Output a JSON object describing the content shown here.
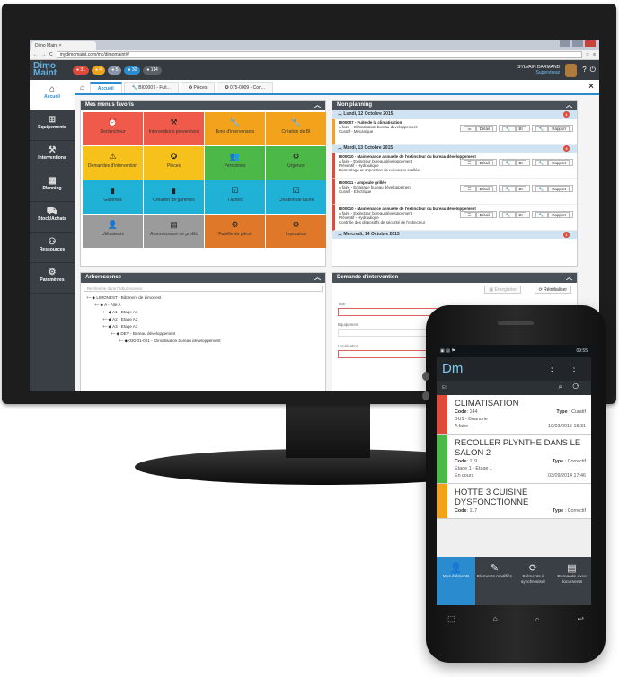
{
  "browser": {
    "tab_title": "Dimo Maint",
    "url": "mydimomaint.com/mc/dimomaint#/"
  },
  "header": {
    "logo": "Dimo Maint",
    "badges": [
      {
        "label": "31",
        "color": "#e04a3a"
      },
      {
        "label": "4",
        "color": "#f2a31b"
      },
      {
        "label": "5",
        "color": "#8a96a8"
      },
      {
        "label": "30",
        "color": "#2a8ccf"
      },
      {
        "label": "114",
        "color": "#5a6068"
      }
    ],
    "user_name": "SYLVAIN DARMAND",
    "user_role": "Superviseur",
    "help_icon": "?",
    "power_icon": "⏻"
  },
  "sidebar": {
    "items": [
      {
        "label": "Accueil",
        "icon": "home-icon",
        "glyph": "⌂"
      },
      {
        "label": "Equipements",
        "icon": "hierarchy-icon",
        "glyph": "⊞"
      },
      {
        "label": "Interventions",
        "icon": "toolbox-icon",
        "glyph": "⚒"
      },
      {
        "label": "Planning",
        "icon": "calendar-icon",
        "glyph": "▦"
      },
      {
        "label": "Stock/Achats",
        "icon": "cart-icon",
        "glyph": "⛟"
      },
      {
        "label": "Ressources",
        "icon": "people-icon",
        "glyph": "⚇"
      },
      {
        "label": "Paramètres",
        "icon": "gears-icon",
        "glyph": "⚙"
      }
    ]
  },
  "tabs": [
    {
      "label": "Accueil"
    },
    {
      "label": "BI00007 - Fuit..."
    },
    {
      "label": "Pièces"
    },
    {
      "label": "075-0009 - Con..."
    }
  ],
  "favorites": {
    "title": "Mes menus favoris",
    "tiles": [
      {
        "label": "Declencheur",
        "color": "#ef5a4a",
        "glyph": "⏰"
      },
      {
        "label": "Interventions préventives",
        "color": "#ef5a4a",
        "glyph": "⚒"
      },
      {
        "label": "Bons d'intervenants",
        "color": "#f2a31b",
        "glyph": "🔧"
      },
      {
        "label": "Création de BI",
        "color": "#f2a31b",
        "glyph": "🔧"
      },
      {
        "label": "Demandes d'intervention",
        "color": "#f6c11b",
        "glyph": "⚠"
      },
      {
        "label": "Pièces",
        "color": "#f6c11b",
        "glyph": "✪"
      },
      {
        "label": "Personnes",
        "color": "#4cb848",
        "glyph": "👥"
      },
      {
        "label": "Urgence",
        "color": "#4cb848",
        "glyph": "⚙"
      },
      {
        "label": "Gammes",
        "color": "#1fb1d6",
        "glyph": "▮"
      },
      {
        "label": "Création de gammes",
        "color": "#1fb1d6",
        "glyph": "▮"
      },
      {
        "label": "Tâches",
        "color": "#1fb1d6",
        "glyph": "☑"
      },
      {
        "label": "Création de tâche",
        "color": "#1fb1d6",
        "glyph": "☑"
      },
      {
        "label": "Utilisateurs",
        "color": "#9b9b9b",
        "glyph": "👤"
      },
      {
        "label": "Arborescence de profils",
        "color": "#9b9b9b",
        "glyph": "▤"
      },
      {
        "label": "Famille de pièce",
        "color": "#e0782a",
        "glyph": "⚙"
      },
      {
        "label": "Imputation",
        "color": "#e0782a",
        "glyph": "⚙"
      }
    ]
  },
  "planning": {
    "title": "Mon planning",
    "days": [
      {
        "label": "Lundi, 12 Octobre 2015",
        "count": "1",
        "rows": [
          {
            "color": "orange",
            "title": "BI00007 - Fuite de la climatisation",
            "l1": "A faire - Climatisation bureau développement",
            "l2": "Curatif - Mécanique",
            "l3": ""
          }
        ]
      },
      {
        "label": "Mardi, 13 Octobre 2015",
        "count": "3",
        "rows": [
          {
            "color": "red",
            "title": "BI00010 - Maintenance annuelle de l'extincteur du bureau développement",
            "l1": "A faire - Extincteur bureau développement",
            "l2": "Préventif - Hydraulique",
            "l3": "Remontage et apposition de nouveaux scellés"
          },
          {
            "color": "red",
            "title": "BI00011 - Ampoule grillée",
            "l1": "A faire - Eclairage bureau développement",
            "l2": "Curatif - Electrique",
            "l3": ""
          },
          {
            "color": "red",
            "title": "BI00010 - Maintenance annuelle de l'extincteur du bureau développement",
            "l1": "A faire - Extincteur bureau développement",
            "l2": "Préventif - Hydraulique",
            "l3": "Contrôle des dispositifs de sécurité de l'extincteur"
          }
        ]
      },
      {
        "label": "Mercredi, 14 Octobre 2015",
        "count": "1",
        "rows": []
      }
    ],
    "btn_detail": "Détail",
    "btn_bi": "BI",
    "btn_rapport": "Rapport"
  },
  "tree": {
    "title": "Arborescence",
    "search_placeholder": "Recherche dans l'arborescence",
    "nodes": [
      {
        "label": "LIMONEST - Bâtiment de Limonest",
        "depth": 0
      },
      {
        "label": "A - Aile A",
        "depth": 1
      },
      {
        "label": "A1 - Etage A1",
        "depth": 2
      },
      {
        "label": "A2 - Etage A2",
        "depth": 2
      },
      {
        "label": "A3 - Etage A3",
        "depth": 2
      },
      {
        "label": "DEV - Bureau développement",
        "depth": 3
      },
      {
        "label": "030-01-001 - Climatisation bureau développement",
        "depth": 4
      }
    ]
  },
  "demand": {
    "title": "Demande d'intervention",
    "btn_save": "Enregistrer",
    "btn_reset": "Réinitialiser",
    "field_title": "Titre",
    "field_equipment": "Equipement",
    "field_location": "Localisation"
  },
  "phone": {
    "status_time": "09:55",
    "app_logo": "Dm",
    "filter_label": "Et",
    "cards": [
      {
        "title": "CLIMATISATION",
        "code_label": "Code",
        "code": "144",
        "loc": "BU1 - Buandrie",
        "status": "A faire",
        "type_label": "Type",
        "type": "Curatif",
        "date": "10/03/2015 15:31",
        "color": "#e04a3a"
      },
      {
        "title": "RECOLLER PLYNTHE DANS LE SALON 2",
        "code_label": "Code",
        "code": "119",
        "loc": "Etage 1 - Etage 1",
        "status": "En cours",
        "type_label": "Type",
        "type": "Correctif",
        "date": "03/09/2014 17:46",
        "color": "#4cb848"
      },
      {
        "title": "HOTTE 3 CUISINE DYSFONCTIONNE",
        "code_label": "Code",
        "code": "117",
        "loc": "",
        "status": "",
        "type_label": "Type",
        "type": "Correctif",
        "date": "",
        "color": "#f2a31b"
      }
    ],
    "nav": [
      {
        "label": "Mes éléments",
        "icon": "user-icon",
        "glyph": "👤"
      },
      {
        "label": "Eléments modifiés",
        "icon": "edit-icon",
        "glyph": "✎"
      },
      {
        "label": "Eléments à synchroniser",
        "icon": "sync-icon",
        "glyph": "⟳"
      },
      {
        "label": "Demande avec documents",
        "icon": "document-icon",
        "glyph": "▤"
      }
    ],
    "keys": [
      "⬚",
      "⌂",
      "⌕",
      "↩"
    ]
  }
}
